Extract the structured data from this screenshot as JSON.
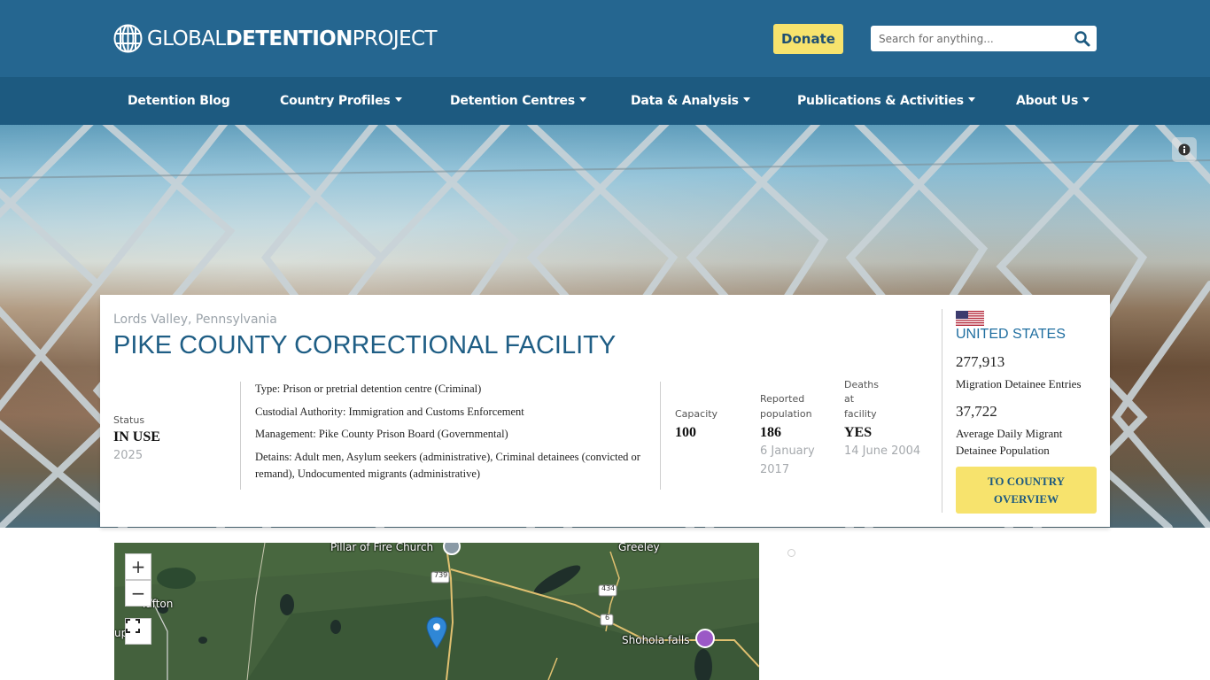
{
  "header": {
    "logo": {
      "part1": "GLOBAL",
      "part2": "DETENTION",
      "part3": "PROJECT",
      "icon": "globe-icon"
    },
    "donate_label": "Donate",
    "search_placeholder": "Search for anything...",
    "search_icon": "search-icon"
  },
  "nav": {
    "items": [
      {
        "label": "Detention Blog",
        "dropdown": false
      },
      {
        "label": "Country Profiles",
        "dropdown": true
      },
      {
        "label": "Detention Centres",
        "dropdown": true
      },
      {
        "label": "Data & Analysis",
        "dropdown": true
      },
      {
        "label": "Publications & Activities",
        "dropdown": true
      },
      {
        "label": "About Us",
        "dropdown": true
      }
    ]
  },
  "hero": {
    "info_icon": "info-icon"
  },
  "facility": {
    "location": "Lords Valley, Pennsylvania",
    "name": "PIKE COUNTY CORRECTIONAL FACILITY",
    "status": {
      "label": "Status",
      "value": "IN USE",
      "year": "2025"
    },
    "details": [
      "Type: Prison or pretrial detention centre (Criminal)",
      "Custodial Authority: Immigration and Customs Enforcement",
      "Management: Pike County Prison Board (Governmental)",
      "Detains: Adult men, Asylum seekers (administrative), Criminal detainees (convicted or remand), Undocumented migrants (administrative)"
    ],
    "capacity": {
      "label": "Capacity",
      "value": "100"
    },
    "reported_population": {
      "label_line1": "Reported",
      "label_line2": "population",
      "value": "186",
      "date_line1": "6 January",
      "date_line2": "2017"
    },
    "deaths": {
      "label_line1": "Deaths",
      "label_line2": "at",
      "label_line3": "facility",
      "value": "YES",
      "date": "14 June 2004"
    }
  },
  "country": {
    "name": "UNITED STATES",
    "flag_icon": "us-flag-icon",
    "entries_value": "277,913",
    "entries_label": "Migration Detainee Entries",
    "daily_value": "37,722",
    "daily_label_line1": "Average Daily Migrant",
    "daily_label_line2": "Detainee Population",
    "overview_line1": "TO COUNTRY",
    "overview_line2": "OVERVIEW"
  },
  "map": {
    "zoom_in": "+",
    "zoom_out": "−",
    "fullscreen_icon": "fullscreen-icon",
    "labels": {
      "church": "Pillar of Fire Church",
      "greeley": "Greeley",
      "tafton": "Tafton",
      "partial": "up",
      "shohola": "Shohola falls",
      "route739": "739",
      "route434": "434",
      "route6": "6"
    },
    "marker_icon": "location-pin-icon"
  }
}
